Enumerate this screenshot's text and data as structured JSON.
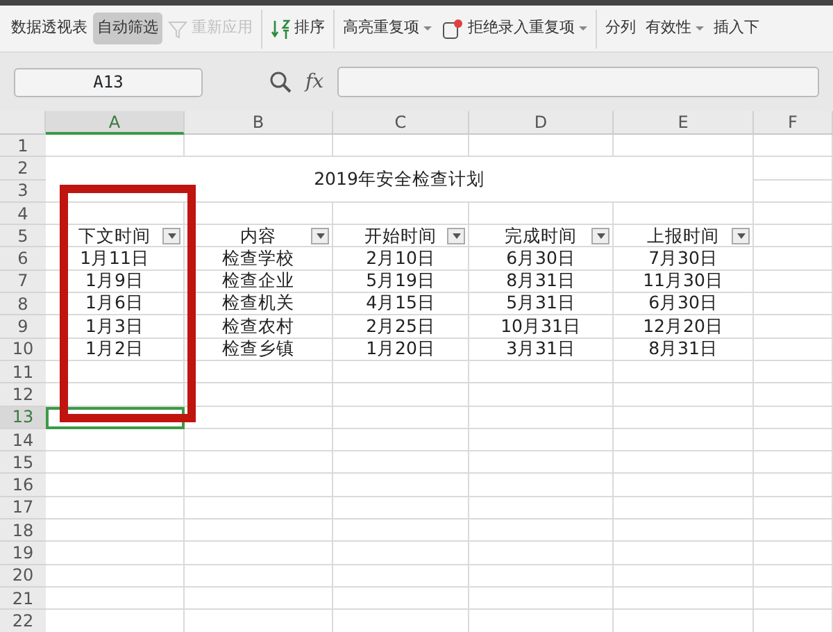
{
  "ribbon": {
    "groups": [
      [
        {
          "label": "数据透视表",
          "kind": "button",
          "selected": false,
          "disabled": false
        },
        {
          "label": "自动筛选",
          "kind": "button",
          "selected": true,
          "disabled": false
        },
        {
          "label": "重新应用",
          "kind": "filter",
          "selected": false,
          "disabled": true
        }
      ],
      [
        {
          "label": "排序",
          "kind": "sort",
          "selected": false,
          "disabled": false
        }
      ],
      [
        {
          "label": "高亮重复项",
          "kind": "dropdown",
          "selected": false,
          "disabled": false
        },
        {
          "label": "拒绝录入重复项",
          "kind": "reject",
          "selected": false,
          "disabled": false
        }
      ],
      [
        {
          "label": "分列",
          "kind": "button",
          "selected": false,
          "disabled": false
        },
        {
          "label": "有效性",
          "kind": "dropdown",
          "selected": false,
          "disabled": false
        },
        {
          "label": "插入下",
          "kind": "button",
          "selected": false,
          "disabled": false
        }
      ]
    ]
  },
  "formula_bar": {
    "name_box": "A13",
    "fx": "fx"
  },
  "sheet": {
    "columns": [
      {
        "label": "A",
        "selected": true
      },
      {
        "label": "B",
        "selected": false
      },
      {
        "label": "C",
        "selected": false
      },
      {
        "label": "D",
        "selected": false
      },
      {
        "label": "E",
        "selected": false
      },
      {
        "label": "F",
        "selected": false
      }
    ],
    "rows": [
      {
        "label": "1",
        "selected": false
      },
      {
        "label": "2",
        "selected": false
      },
      {
        "label": "3",
        "selected": false
      },
      {
        "label": "4",
        "selected": false
      },
      {
        "label": "5",
        "selected": false
      },
      {
        "label": "6",
        "selected": false
      },
      {
        "label": "7",
        "selected": false
      },
      {
        "label": "8",
        "selected": false
      },
      {
        "label": "9",
        "selected": false
      },
      {
        "label": "10",
        "selected": false
      },
      {
        "label": "11",
        "selected": false
      },
      {
        "label": "12",
        "selected": false
      },
      {
        "label": "13",
        "selected": true
      },
      {
        "label": "14",
        "selected": false
      },
      {
        "label": "15",
        "selected": false
      },
      {
        "label": "16",
        "selected": false
      },
      {
        "label": "17",
        "selected": false
      },
      {
        "label": "18",
        "selected": false
      },
      {
        "label": "19",
        "selected": false
      },
      {
        "label": "20",
        "selected": false
      },
      {
        "label": "21",
        "selected": false
      },
      {
        "label": "22",
        "selected": false
      }
    ],
    "title": "2019年安全检查计划",
    "headers": [
      "下文时间",
      "内容",
      "开始时间",
      "完成时间",
      "上报时间"
    ],
    "records": [
      [
        "1月11日",
        "检查学校",
        "2月10日",
        "6月30日",
        "7月30日"
      ],
      [
        "1月9日",
        "检查企业",
        "5月19日",
        "8月31日",
        "11月30日"
      ],
      [
        "1月6日",
        "检查机关",
        "4月15日",
        "5月31日",
        "6月30日"
      ],
      [
        "1月3日",
        "检查农村",
        "2月25日",
        "10月31日",
        "12月20日"
      ],
      [
        "1月2日",
        "检查乡镇",
        "1月20日",
        "3月31日",
        "8月31日"
      ]
    ]
  }
}
